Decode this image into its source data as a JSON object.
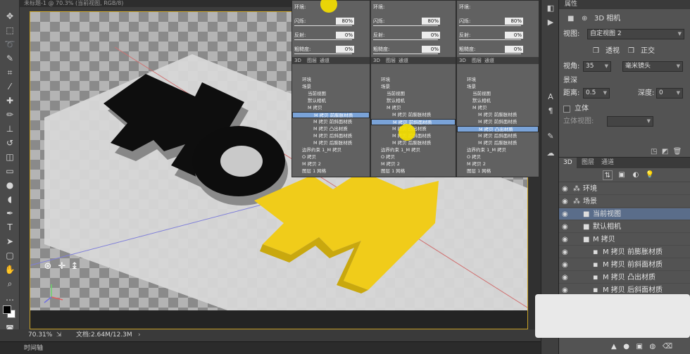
{
  "document": {
    "tab_title": "未标题-1 @ 70.3% (当前视图, RGB/8)"
  },
  "status": {
    "zoom": "70.31%",
    "doc_size": "文档:2.64M/12.3M",
    "timeline": "时间轴"
  },
  "canvas": {
    "letters_dark": "MO",
    "letters_yellow": "M"
  },
  "properties": {
    "tab": "属性",
    "header": "3D 相机",
    "view_label": "视图:",
    "view_value": "自定视图 2",
    "perspective": "透视",
    "ortho": "正交",
    "fov_label": "视角:",
    "fov_value": "35",
    "lens_unit": "毫米镜头",
    "dof_label": "景深",
    "distance_label": "距离:",
    "distance_value": "0.5",
    "depth_label": "深度:",
    "depth_value": "0",
    "stereo_label": "立体",
    "stereo_view_label": "立体视图:"
  },
  "panel3d": {
    "tabs": [
      "3D",
      "图层",
      "通道"
    ],
    "layers": [
      {
        "label": "环境",
        "indent": 0,
        "selected": false
      },
      {
        "label": "场景",
        "indent": 0,
        "selected": false
      },
      {
        "label": "当前视图",
        "indent": 1,
        "selected": true
      },
      {
        "label": "默认相机",
        "indent": 1,
        "selected": false
      },
      {
        "label": "M 拷贝",
        "indent": 1,
        "selected": false
      },
      {
        "label": "M 拷贝 前膨胀材质",
        "indent": 2,
        "selected": false
      },
      {
        "label": "M 拷贝 前斜面材质",
        "indent": 2,
        "selected": false
      },
      {
        "label": "M 拷贝 凸出材质",
        "indent": 2,
        "selected": false
      },
      {
        "label": "M 拷贝 后斜面材质",
        "indent": 2,
        "selected": false
      },
      {
        "label": "M 拷贝 后膨胀材质",
        "indent": 2,
        "selected": false
      }
    ]
  },
  "floating_panels": {
    "sliders": [
      {
        "label": "环境:",
        "value": ""
      },
      {
        "label": "闪烁:",
        "value": "80%"
      },
      {
        "label": "反射:",
        "value": "0%"
      },
      {
        "label": "粗糙度:",
        "value": "0%"
      }
    ],
    "tabs": [
      "3D",
      "图层",
      "通道"
    ],
    "panel_a_rows": [
      {
        "label": "环境",
        "selected": false
      },
      {
        "label": "场景",
        "selected": false
      },
      {
        "label": "当前视图",
        "selected": false
      },
      {
        "label": "默认相机",
        "selected": false
      },
      {
        "label": "M 拷贝",
        "selected": false
      },
      {
        "label": "M 拷贝 前膨胀材质",
        "selected": true
      },
      {
        "label": "M 拷贝 前斜面材质",
        "selected": false
      },
      {
        "label": "M 拷贝 凸出材质",
        "selected": false
      },
      {
        "label": "M 拷贝 后斜面材质",
        "selected": false
      },
      {
        "label": "M 拷贝 后膨胀材质",
        "selected": false
      },
      {
        "label": "边界约束 1_M 拷贝",
        "selected": false
      },
      {
        "label": "O 拷贝",
        "selected": false
      },
      {
        "label": "M 拷贝 2",
        "selected": false
      },
      {
        "label": "图层 1 网格",
        "selected": false
      }
    ],
    "panel_b_rows": [
      {
        "label": "环境",
        "selected": false
      },
      {
        "label": "场景",
        "selected": false
      },
      {
        "label": "当前视图",
        "selected": false
      },
      {
        "label": "默认相机",
        "selected": false
      },
      {
        "label": "M 拷贝",
        "selected": false
      },
      {
        "label": "M 拷贝 前膨胀材质",
        "selected": false
      },
      {
        "label": "M 拷贝 前斜面材质",
        "selected": true
      },
      {
        "label": "M 拷贝 凸出材质",
        "selected": false
      },
      {
        "label": "M 拷贝 后斜面材质",
        "selected": false
      },
      {
        "label": "M 拷贝 后膨胀材质",
        "selected": false
      },
      {
        "label": "边界约束 1_M 拷贝",
        "selected": false
      },
      {
        "label": "O 拷贝",
        "selected": false
      },
      {
        "label": "M 拷贝 2",
        "selected": false
      },
      {
        "label": "图层 1 网格",
        "selected": false
      }
    ],
    "panel_c_rows": [
      {
        "label": "环境",
        "selected": false
      },
      {
        "label": "场景",
        "selected": false
      },
      {
        "label": "当前视图",
        "selected": false
      },
      {
        "label": "默认相机",
        "selected": false
      },
      {
        "label": "M 拷贝",
        "selected": false
      },
      {
        "label": "M 拷贝 前膨胀材质",
        "selected": false
      },
      {
        "label": "M 拷贝 前斜面材质",
        "selected": false
      },
      {
        "label": "M 拷贝 凸出材质",
        "selected": true
      },
      {
        "label": "M 拷贝 后斜面材质",
        "selected": false
      },
      {
        "label": "M 拷贝 后膨胀材质",
        "selected": false
      },
      {
        "label": "边界约束 1_M 拷贝",
        "selected": false
      },
      {
        "label": "O 拷贝",
        "selected": false
      },
      {
        "label": "M 拷贝 2",
        "selected": false
      },
      {
        "label": "图层 1 网格",
        "selected": false
      }
    ]
  },
  "colors": {
    "accent_yellow": "#f0cc1a",
    "selection_blue": "#7aa3d8",
    "canvas_border": "#c9a227"
  }
}
